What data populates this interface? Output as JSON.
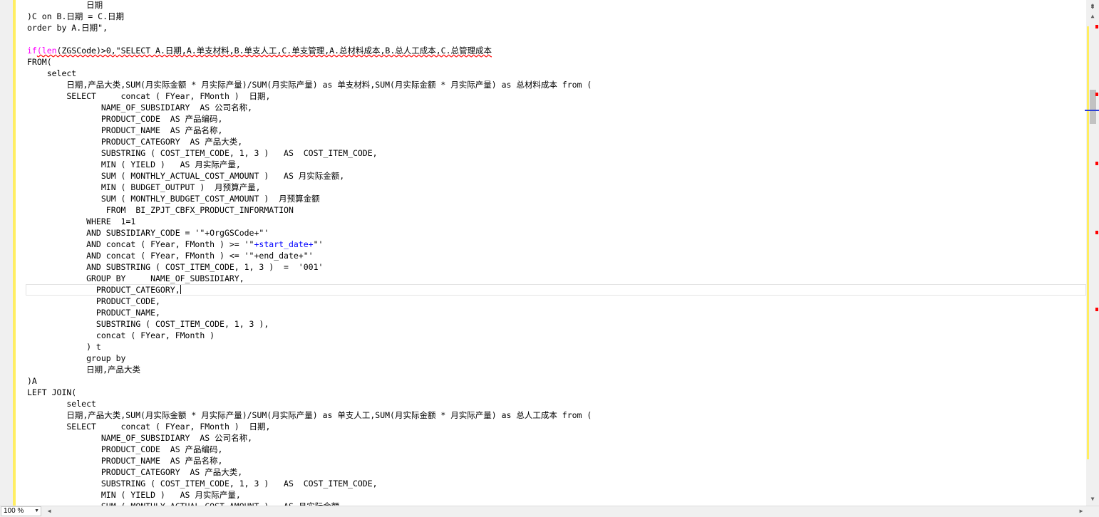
{
  "editor": {
    "zoom": "100 %",
    "lines": [
      "            日期",
      ")C on B.日期 = C.日期",
      "order by A.日期\",",
      "",
      "__IF_LINE__",
      "FROM(",
      "    select",
      "        日期,产品大类,SUM(月实际金额 * 月实际产量)/SUM(月实际产量) as 单支材料,SUM(月实际金额 * 月实际产量) as 总材料成本 from (",
      "        SELECT     concat ( FYear, FMonth )  日期,",
      "               NAME_OF_SUBSIDIARY  AS 公司名称,",
      "               PRODUCT_CODE  AS 产品编码,",
      "               PRODUCT_NAME  AS 产品名称,",
      "               PRODUCT_CATEGORY  AS 产品大类,",
      "               SUBSTRING ( COST_ITEM_CODE, 1, 3 )   AS  COST_ITEM_CODE,",
      "               MIN ( YIELD )   AS 月实际产量,",
      "               SUM ( MONTHLY_ACTUAL_COST_AMOUNT )   AS 月实际金额,",
      "               MIN ( BUDGET_OUTPUT )  月预算产量,",
      "               SUM ( MONTHLY_BUDGET_COST_AMOUNT )  月预算金额",
      "                FROM  BI_ZPJT_CBFX_PRODUCT_INFORMATION",
      "            WHERE  1=1",
      "            AND SUBSIDIARY_CODE = '\"+OrgGSCode+\"'",
      "__START_LINE__",
      "            AND concat ( FYear, FMonth ) <= '\"+end_date+\"'",
      "            AND SUBSTRING ( COST_ITEM_CODE, 1, 3 )  =  '001'",
      "            GROUP BY     NAME_OF_SUBSIDIARY,",
      "__CARET_LINE__",
      "              PRODUCT_CODE,",
      "              PRODUCT_NAME,",
      "              SUBSTRING ( COST_ITEM_CODE, 1, 3 ),",
      "              concat ( FYear, FMonth )",
      "            ) t",
      "            group by",
      "            日期,产品大类",
      ")A",
      "LEFT JOIN(",
      "        select",
      "        日期,产品大类,SUM(月实际金额 * 月实际产量)/SUM(月实际产量) as 单支人工,SUM(月实际金额 * 月实际产量) as 总人工成本 from (",
      "        SELECT     concat ( FYear, FMonth )  日期,",
      "               NAME_OF_SUBSIDIARY  AS 公司名称,",
      "               PRODUCT_CODE  AS 产品编码,",
      "               PRODUCT_NAME  AS 产品名称,",
      "               PRODUCT_CATEGORY  AS 产品大类,",
      "               SUBSTRING ( COST_ITEM_CODE, 1, 3 )   AS  COST_ITEM_CODE,",
      "               MIN ( YIELD )   AS 月实际产量,",
      "               SUM ( MONTHLY_ACTUAL_COST_AMOUNT )   AS 月实际金额,"
    ],
    "if_line": {
      "kw_if": "if",
      "open": "(",
      "fn_len": "len",
      "arg": "(ZGSCode)>0,",
      "rest": "\"SELECT A.日期,A.单支材料,B.单支人工,C.单支管理,A.总材料成本,B.总人工成本,C.总管理成本"
    },
    "start_line": {
      "prefix": "            AND concat ( FYear, FMonth ) >= '\"",
      "var": "+start_date+",
      "suffix": "\"'"
    },
    "caret_line": "              PRODUCT_CATEGORY,"
  },
  "scrollbar": {
    "split_glyph": "⇟",
    "up_glyph": "▲",
    "down_glyph": "▼",
    "left_glyph": "◀",
    "right_glyph": "▶",
    "accent": "#ffee62",
    "error_color": "#ff0000"
  }
}
